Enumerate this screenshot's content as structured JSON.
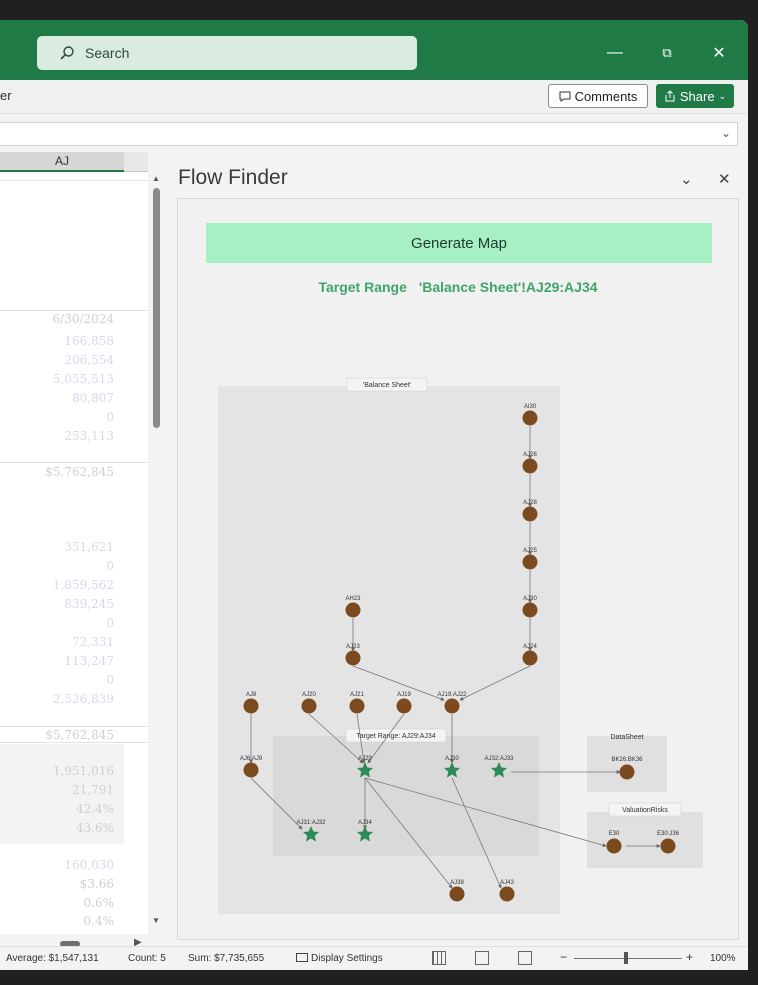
{
  "titlebar": {
    "search_placeholder": "Search",
    "minimize": "—",
    "restore": "⧉",
    "close": "✕"
  },
  "ribbon": {
    "left_fragment": "er",
    "comments_label": "Comments",
    "share_label": "Share"
  },
  "grid": {
    "column_header": "AJ",
    "cells": [
      "6/30/2024",
      "166,858",
      "206,554",
      "5,055,513",
      "80,807",
      "0",
      "253,113",
      "$5,762,845",
      "351,621",
      "0",
      "1,859,562",
      "839,245",
      "0",
      "72,331",
      "113,247",
      "0",
      "2,526,839",
      "$5,762,845",
      "1,951,016",
      "21,791",
      "42.4%",
      "43.6%",
      "160,030",
      "$3.66",
      "0.6%",
      "0.4%"
    ]
  },
  "pane": {
    "title": "Flow Finder",
    "generate_button": "Generate Map",
    "target_label": "Target Range",
    "target_value": "'Balance Sheet'!AJ29:AJ34",
    "clusters": {
      "balance_sheet": "'Balance Sheet'",
      "target_range": "Target Range: AJ29:AJ34",
      "datasheet": "DataSheet",
      "valuation": "ValuationRisks"
    },
    "nodes": {
      "ai30": "AI30",
      "aj26": "AJ26",
      "aj28": "AJ28",
      "aj25": "AJ25",
      "aj30": "AJ30",
      "ah23": "AH23",
      "aj23b": "AJ23",
      "aj24": "AJ24",
      "aj8": "AJ8",
      "aj20": "AJ20",
      "aj21": "AJ21",
      "aj19": "AJ19",
      "aj19_22": "AJ19:AJ22",
      "aj6_9": "AJ6:AJ9",
      "aj29": "AJ29",
      "aj30t": "AJ30",
      "aj32_33": "AJ32:AJ33",
      "aj31_32": "AJ31:AJ32",
      "aj34": "AJ34",
      "aj38": "AJ38",
      "aj43": "AJ43",
      "bk26": "BK26:BK36",
      "e30": "E30",
      "e36": "E30:J36"
    }
  },
  "status": {
    "average": "Average: $1,547,131",
    "count": "Count: 5",
    "sum": "Sum: $7,735,655",
    "display_settings": "Display Settings",
    "zoom_minus": "−",
    "zoom_plus": "+",
    "zoom_level": "100%"
  },
  "colors": {
    "excel_green": "#1f7a45",
    "node_brown": "#7b4a1e",
    "target_star": "#2e8b57",
    "button_mint": "#a6f0c4"
  }
}
